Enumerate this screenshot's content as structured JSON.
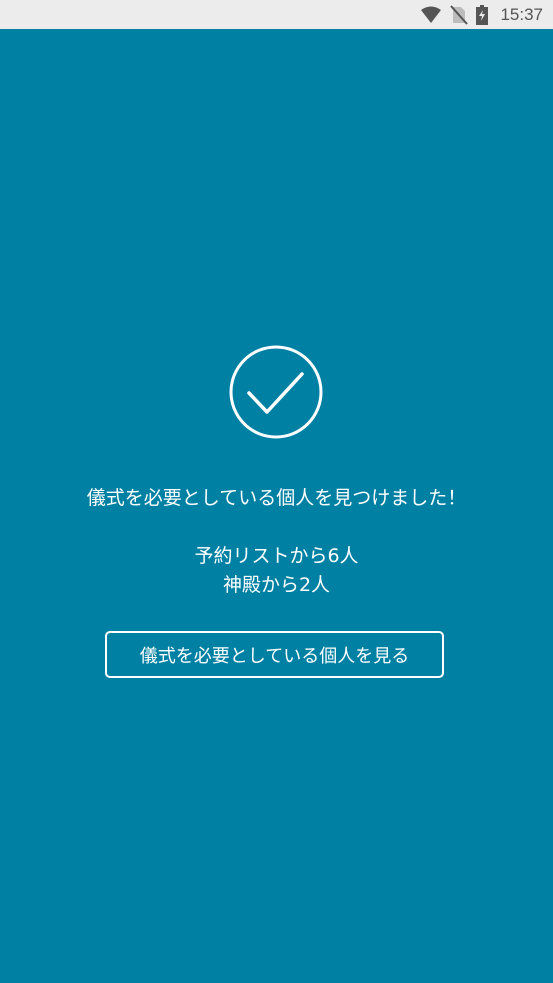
{
  "status_bar": {
    "time": "15:37",
    "icons": [
      "wifi-icon",
      "no-sim-icon",
      "battery-charging-icon"
    ]
  },
  "main": {
    "icon": "checkmark-circle-icon",
    "headline": "儀式を必要としている個人を見つけました！",
    "counts": {
      "from_reservation_list": "予約リストから6人",
      "from_temple": "神殿から2人"
    },
    "view_button_label": "儀式を必要としている個人を見る"
  },
  "colors": {
    "background": "#0081a3",
    "status_bar": "#ececec",
    "foreground": "#ffffff"
  }
}
